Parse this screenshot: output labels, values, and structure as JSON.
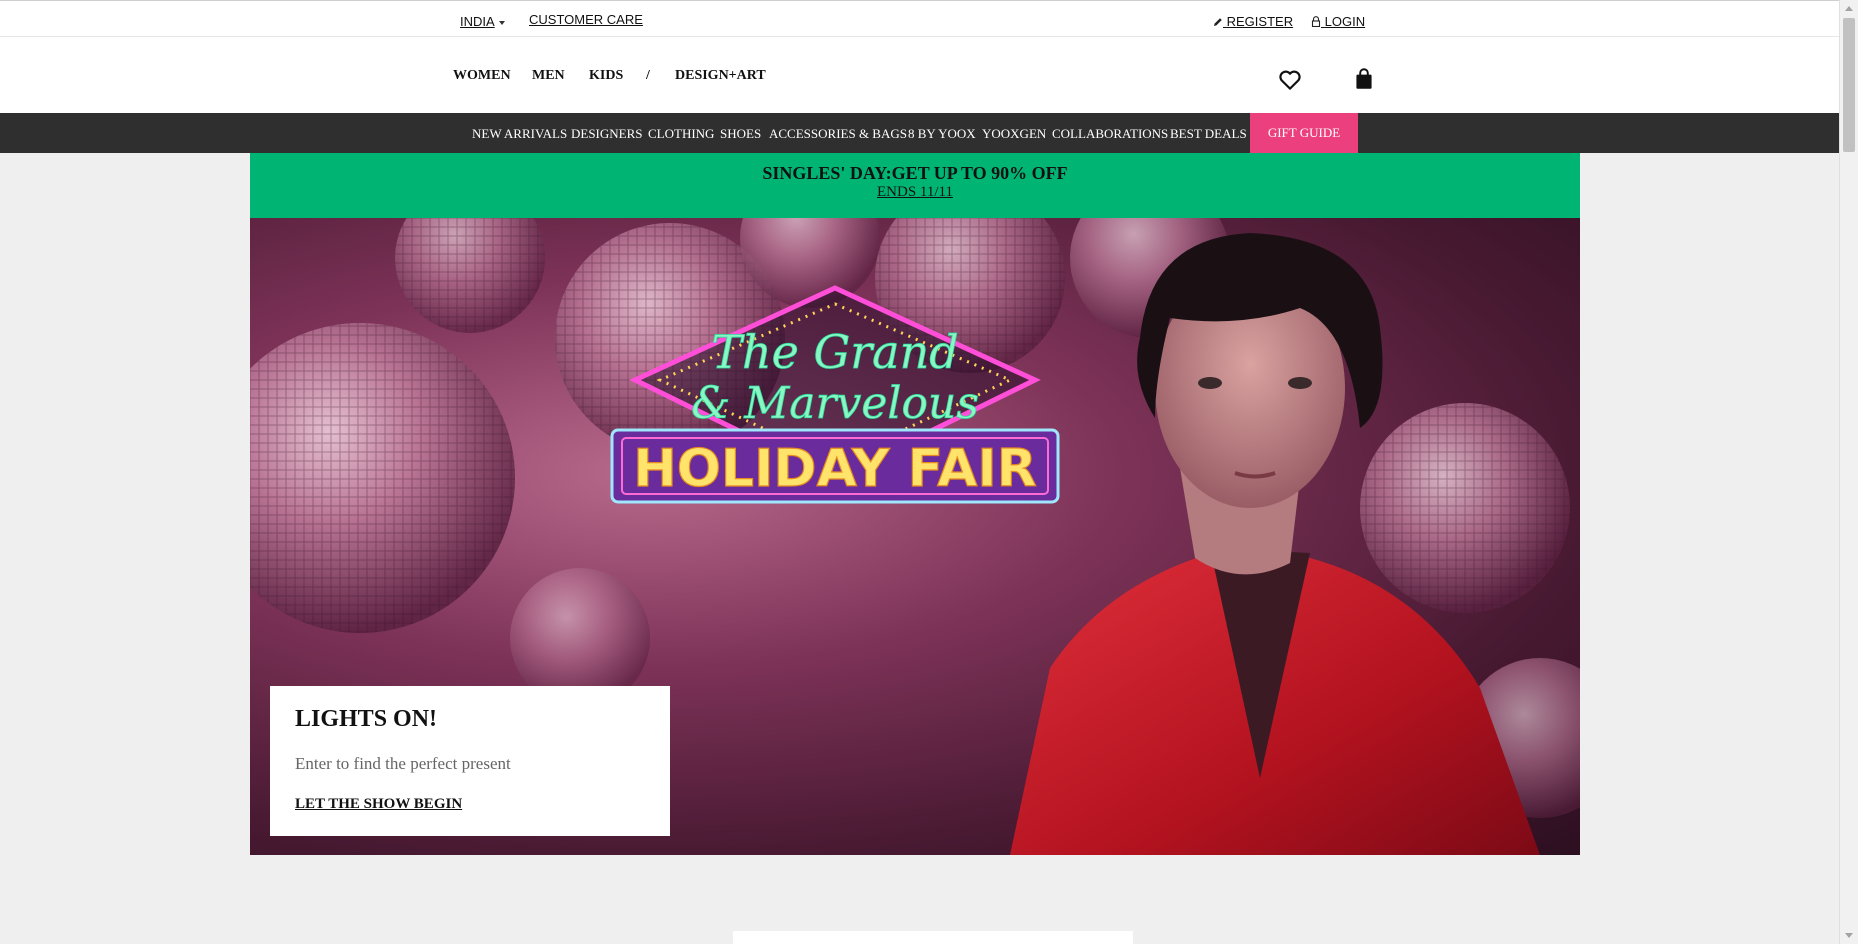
{
  "utility": {
    "country": "INDIA",
    "customer_care": "CUSTOMER CARE",
    "register": "REGISTER",
    "login": "LOGIN"
  },
  "header": {
    "nav": [
      "WOMEN",
      "MEN",
      "KIDS",
      "/",
      "DESIGN+ART"
    ],
    "icons": [
      "heart-icon",
      "shopping-bag-icon"
    ]
  },
  "categories": [
    "NEW ARRIVALS",
    "DESIGNERS",
    "CLOTHING",
    "SHOES",
    "ACCESSORIES & BAGS",
    "8 BY YOOX",
    "YOOXGEN",
    "COLLABORATIONS",
    "BEST DEALS",
    "GIFT GUIDE"
  ],
  "promo": {
    "title": "SINGLES' DAY:GET UP TO 90% OFF",
    "subtitle": "ENDS 11/11"
  },
  "hero": {
    "sign_script_line1": "The Grand",
    "sign_script_line2": "& Marvelous",
    "sign_title": "HOLIDAY FAIR",
    "card_heading": "LIGHTS ON!",
    "card_text": "Enter to find the perfect present",
    "card_link": "LET THE SHOW BEGIN"
  },
  "colors": {
    "category_bar": "#2f2f2f",
    "gift_guide": "#ec3f7d",
    "promo": "#00b574",
    "page_bg": "#efefef"
  }
}
